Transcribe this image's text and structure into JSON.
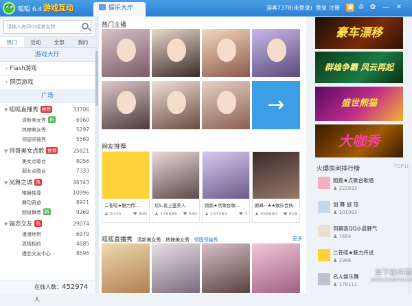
{
  "titlebar": {
    "app_name": "呱呱 6.4",
    "promo_text": "游戏互动",
    "active_tab": "娱乐大厅",
    "guest": "游客7378(未登录)",
    "login": "登录",
    "register": "注册",
    "icons": [
      "gift-icon",
      "shirt-icon",
      "settings-icon",
      "minimize-icon",
      "close-icon"
    ]
  },
  "sidebar": {
    "search_placeholder": "请输入房间ID或者名称",
    "tabs": [
      "热门",
      "活动",
      "全部",
      "我的"
    ],
    "section_games": "游戏大厅",
    "game_items": [
      "Flash游戏",
      "网页游戏"
    ],
    "section_plaza": "广场",
    "rooms": [
      {
        "name": "呱呱直播秀",
        "badge": "推荐",
        "badge_color": "#e4393c",
        "count": "33706",
        "subs": [
          {
            "name": "清新美女秀",
            "badge": "新",
            "badge_color": "#5cb85c",
            "count": "6960"
          },
          {
            "name": "热辣美女秀",
            "count": "5297"
          },
          {
            "name": "领国领袖秀",
            "count": "5569"
          }
        ]
      },
      {
        "name": "帅哥美女点歌",
        "badge": "推荐",
        "badge_color": "#e4393c",
        "count": "25821",
        "subs": [
          {
            "name": "美女点歌台",
            "count": "8056"
          },
          {
            "name": "靓女点歌台",
            "count": "7333"
          }
        ]
      },
      {
        "name": "尚舞之城",
        "badge": "热",
        "badge_color": "#e4393c",
        "count": "46343",
        "subs": [
          {
            "name": "唯舞独尊",
            "count": "10996"
          },
          {
            "name": "舞动奇迹",
            "count": "8921"
          },
          {
            "name": "超级舞者",
            "badge": "新",
            "badge_color": "#5cb85c",
            "count": "9269"
          }
        ]
      },
      {
        "name": "嫚恋交友",
        "badge": "热",
        "badge_color": "#e4393c",
        "count": "29074",
        "subs": [
          {
            "name": "漫漫地带",
            "count": "6979"
          },
          {
            "name": "真情相约",
            "count": "4685"
          },
          {
            "name": "嫚恋交友中心",
            "count": "8696"
          }
        ]
      }
    ],
    "online_label": "在线人数：",
    "online_count": "452974",
    "online_unit": "人"
  },
  "main": {
    "hot_anchors_title": "热门主播",
    "friends_title": "网友推荐",
    "friend_cards": [
      {
        "name": "二苍呱★魅力传...",
        "viewers": "2035",
        "fans": "999"
      },
      {
        "name": "炫S.夜上盛美人",
        "viewers": "178888",
        "fans": "530"
      },
      {
        "name": "跑跑★点歌台歌...",
        "viewers": "203364",
        "fans": "0"
      },
      {
        "name": "颜峰~★★娱乐会所",
        "viewers": "356690",
        "fans": "818"
      }
    ],
    "show_title": "呱呱直播秀",
    "show_tabs": [
      "清新美女秀",
      "热辣美女秀",
      "领国领袖秀"
    ],
    "more": "更多"
  },
  "right": {
    "banners": [
      "豪车漂移",
      "群雄争霸 风云再起",
      "盛世熊猫",
      "大咖秀"
    ],
    "rank_title": "火爆房间排行榜",
    "rank_tag": "TOP10",
    "ranks": [
      {
        "name": "跑跑★点歌台歌唱",
        "count": "222833"
      },
      {
        "name": "创 舞 旅 馆",
        "count": "101983"
      },
      {
        "name": "到赛我QQ小晨脾气",
        "count": "7654"
      },
      {
        "name": "二苍呱★魅力传说",
        "count": "3366"
      },
      {
        "name": "名人娱乐舞",
        "count": "178111"
      }
    ]
  },
  "watermark": {
    "text": "当下软件园",
    "sub": "WWW.DOWNXIA.COM"
  },
  "colors": {
    "accent": "#2c7fd2",
    "titlebar": "#3b8fdc",
    "hot_badge": "#e4393c",
    "new_badge": "#5cb85c"
  }
}
